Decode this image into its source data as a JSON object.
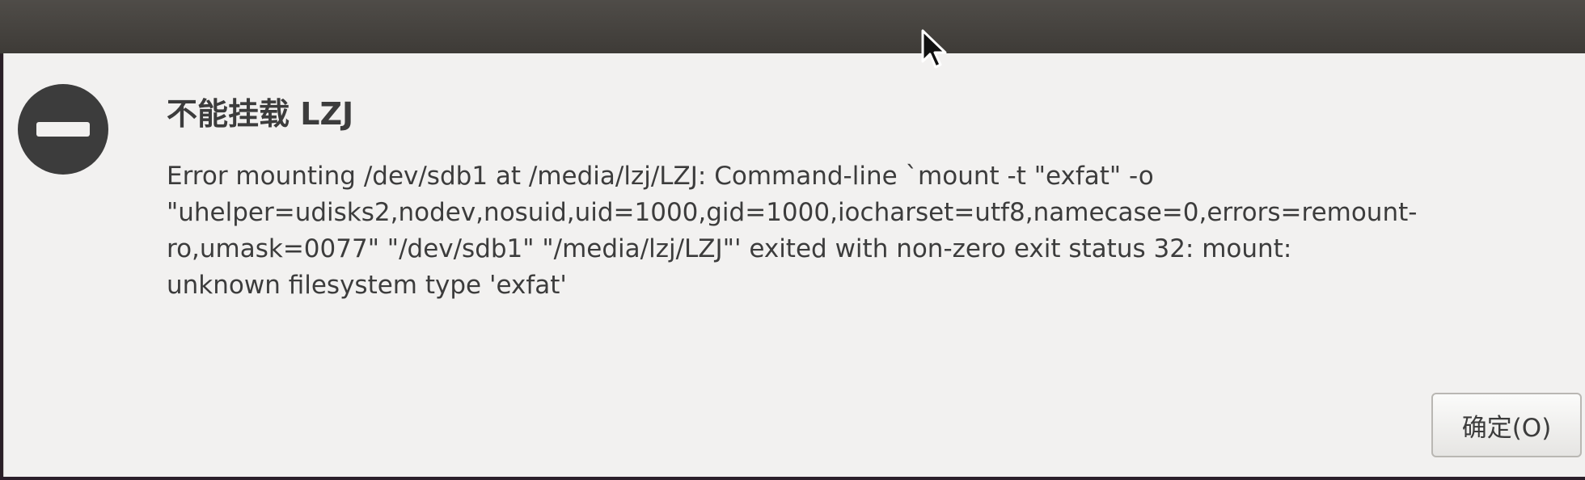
{
  "dialog": {
    "title": "不能挂载 LZJ",
    "message_lines": [
      "Error mounting /dev/sdb1 at /media/lzj/LZJ: Command-line `mount -t \"exfat\" -o",
      "\"uhelper=udisks2,nodev,nosuid,uid=1000,gid=1000,iocharset=utf8,namecase=0,errors=remount-",
      "ro,umask=0077\" \"/dev/sdb1\" \"/media/lzj/LZJ\"' exited with non-zero exit status 32: mount:",
      "unknown filesystem type 'exfat'"
    ],
    "ok_label": "确定(O)"
  },
  "icons": {
    "dialog_icon": "error-icon",
    "pointer": "mouse-cursor-icon"
  },
  "colors": {
    "titlebar": "#3e3b37",
    "dialog_background": "#f2f1f0",
    "text": "#3c3c3c",
    "icon": "#3c3c3c"
  }
}
